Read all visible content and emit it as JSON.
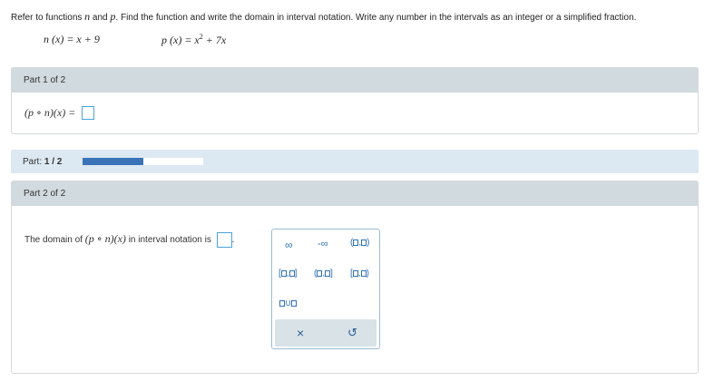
{
  "instructions": {
    "part1": "Refer to functions ",
    "var_n": "n",
    "and": " and ",
    "var_p": "p",
    "part2": ". Find the function and write the domain in interval notation. Write any number in the intervals as an integer or a simplified fraction."
  },
  "functions": {
    "n_lhs": "n (x) = ",
    "n_rhs": "x + 9",
    "p_lhs": "p (x) = ",
    "p_x": "x",
    "p_exp": "2",
    "p_rest": " + 7x"
  },
  "part1": {
    "header": "Part 1 of 2",
    "expr": "(p ∘ n)(x) ="
  },
  "progress": {
    "label": "Part:",
    "count": "1 / 2",
    "fraction": 0.5
  },
  "part2": {
    "header": "Part 2 of 2",
    "prefix": "The domain of ",
    "expr": "(p ∘ n)(x)",
    "suffix": " in interval notation is",
    "end": "."
  },
  "palette": {
    "infinity": "∞",
    "neg_infinity": "-∞",
    "comma": ",",
    "union": "∪",
    "clear": "×",
    "undo": "↺"
  },
  "colors": {
    "accent": "#3b73b9",
    "input_border": "#4aa3df",
    "header_bg": "#d1dade"
  }
}
